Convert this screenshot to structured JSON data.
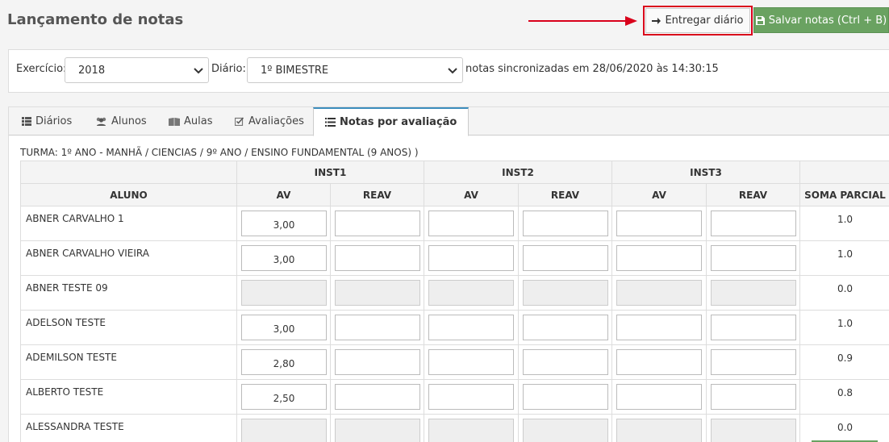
{
  "header": {
    "title": "Lançamento de notas",
    "deliver_label": "Entregar diário",
    "save_label": "Salvar notas (Ctrl + B)"
  },
  "filters": {
    "exercicio_label": "Exercício:",
    "exercicio_value": "2018",
    "diario_label": "Diário:",
    "diario_value": "1º BIMESTRE",
    "sync_text": "notas sincronizadas em 28/06/2020 às 14:30:15"
  },
  "tabs": [
    {
      "label": "Diários",
      "icon": "list-icon"
    },
    {
      "label": "Alunos",
      "icon": "users-icon"
    },
    {
      "label": "Aulas",
      "icon": "book-icon"
    },
    {
      "label": "Avaliações",
      "icon": "check-square-icon"
    },
    {
      "label": "Notas por avaliação",
      "icon": "list-ol-icon",
      "active": true
    }
  ],
  "turma": "TURMA: 1º ANO - MANHÃ / CIENCIAS / 9º ANO / ENSINO FUNDAMENTAL (9 ANOS) )",
  "table": {
    "groups": [
      "INST1",
      "INST2",
      "INST3"
    ],
    "col_aluno": "ALUNO",
    "col_av": "AV",
    "col_reav": "REAV",
    "col_soma": "SOMA PARCIAL",
    "rows": [
      {
        "name": "ABNER CARVALHO 1",
        "disabled": false,
        "inst1_av": "3,00",
        "soma": "1.0"
      },
      {
        "name": "ABNER CARVALHO VIEIRA",
        "disabled": false,
        "inst1_av": "3,00",
        "soma": "1.0"
      },
      {
        "name": "ABNER TESTE 09",
        "disabled": true,
        "inst1_av": "",
        "soma": "0.0"
      },
      {
        "name": "ADELSON TESTE",
        "disabled": false,
        "inst1_av": "3,00",
        "soma": "1.0"
      },
      {
        "name": "ADEMILSON TESTE",
        "disabled": false,
        "inst1_av": "2,80",
        "soma": "0.9"
      },
      {
        "name": "ALBERTO TESTE",
        "disabled": false,
        "inst1_av": "2,50",
        "soma": "0.8"
      },
      {
        "name": "ALESSANDRA TESTE",
        "disabled": true,
        "inst1_av": "",
        "soma": "0.0"
      }
    ]
  },
  "colors": {
    "save_green": "#6aa261",
    "highlight_red": "#d9001b",
    "tab_accent": "#3c8dbc"
  }
}
